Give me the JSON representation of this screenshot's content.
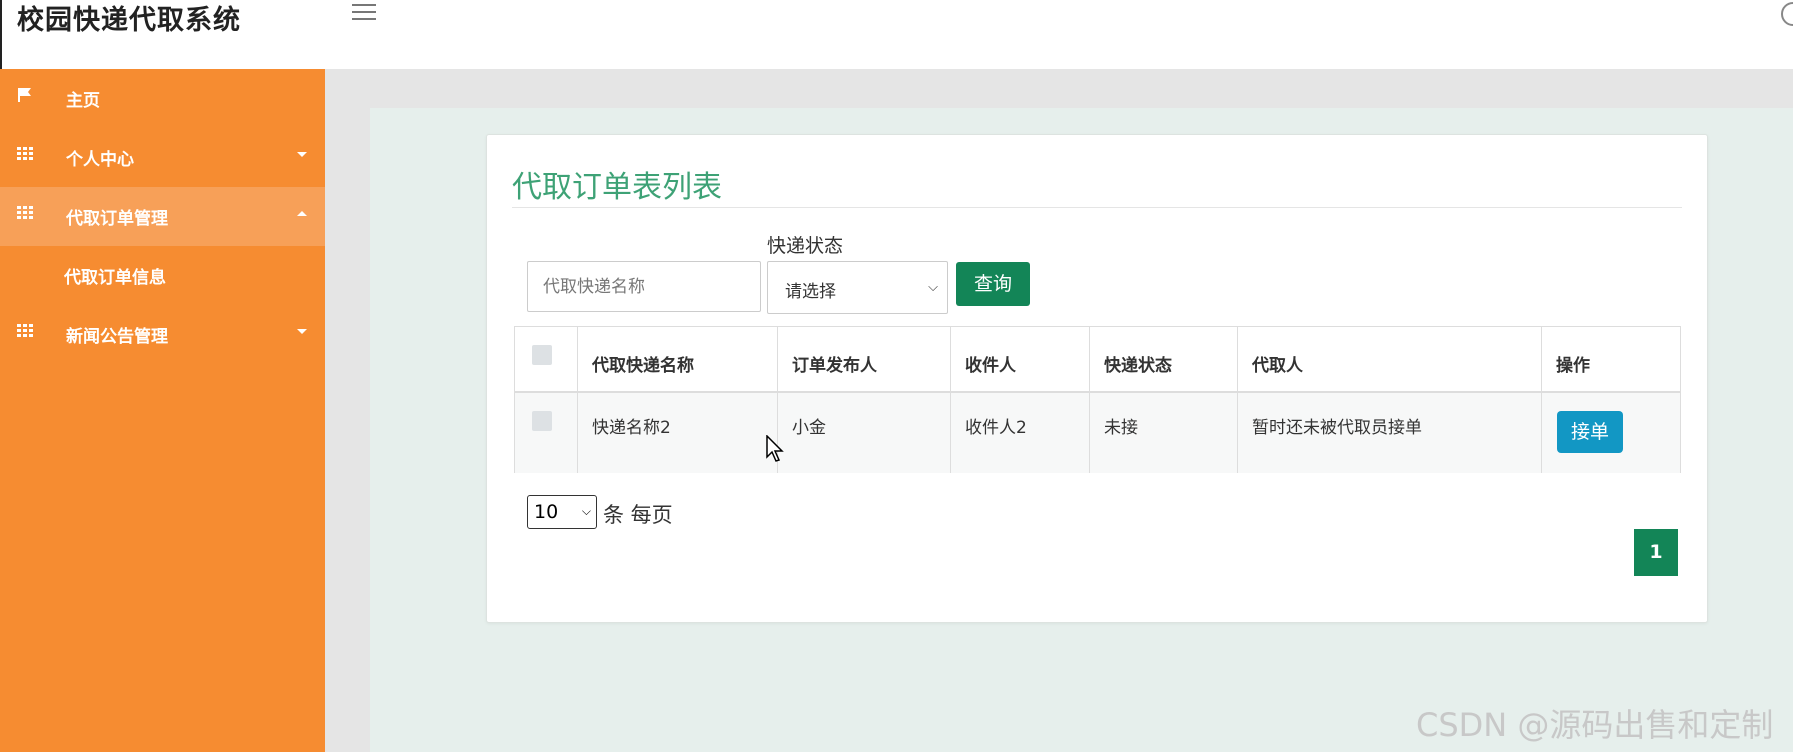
{
  "header": {
    "app_title": "校园快递代取系统"
  },
  "sidebar": {
    "items": [
      {
        "label": "主页",
        "icon": "flag-icon"
      },
      {
        "label": "个人中心",
        "icon": "grid-icon"
      },
      {
        "label": "代取订单管理",
        "icon": "grid-icon"
      },
      {
        "label": "代取订单信息"
      },
      {
        "label": "新闻公告管理",
        "icon": "grid-icon"
      }
    ]
  },
  "main": {
    "title": "代取订单表列表",
    "search": {
      "name_placeholder": "代取快递名称",
      "status_label": "快递状态",
      "status_value": "请选择",
      "query_label": "查询"
    },
    "table": {
      "columns": [
        "代取快递名称",
        "订单发布人",
        "收件人",
        "快递状态",
        "代取人",
        "操作"
      ],
      "rows": [
        {
          "name": "快递名称2",
          "publisher": "小金",
          "recipient": "收件人2",
          "status": "未接",
          "agent": "暂时还未被代取员接单",
          "action": "接单"
        }
      ]
    },
    "pagination": {
      "page_size": "10",
      "page_size_suffix": "条 每页",
      "current_page": "1"
    }
  },
  "watermark": "CSDN @源码出售和定制",
  "colors": {
    "sidebar": "#f68c31",
    "sidebar_active": "#f7a058",
    "title_green": "#3ea276",
    "primary": "#138557",
    "accept_button": "#1297c4"
  }
}
